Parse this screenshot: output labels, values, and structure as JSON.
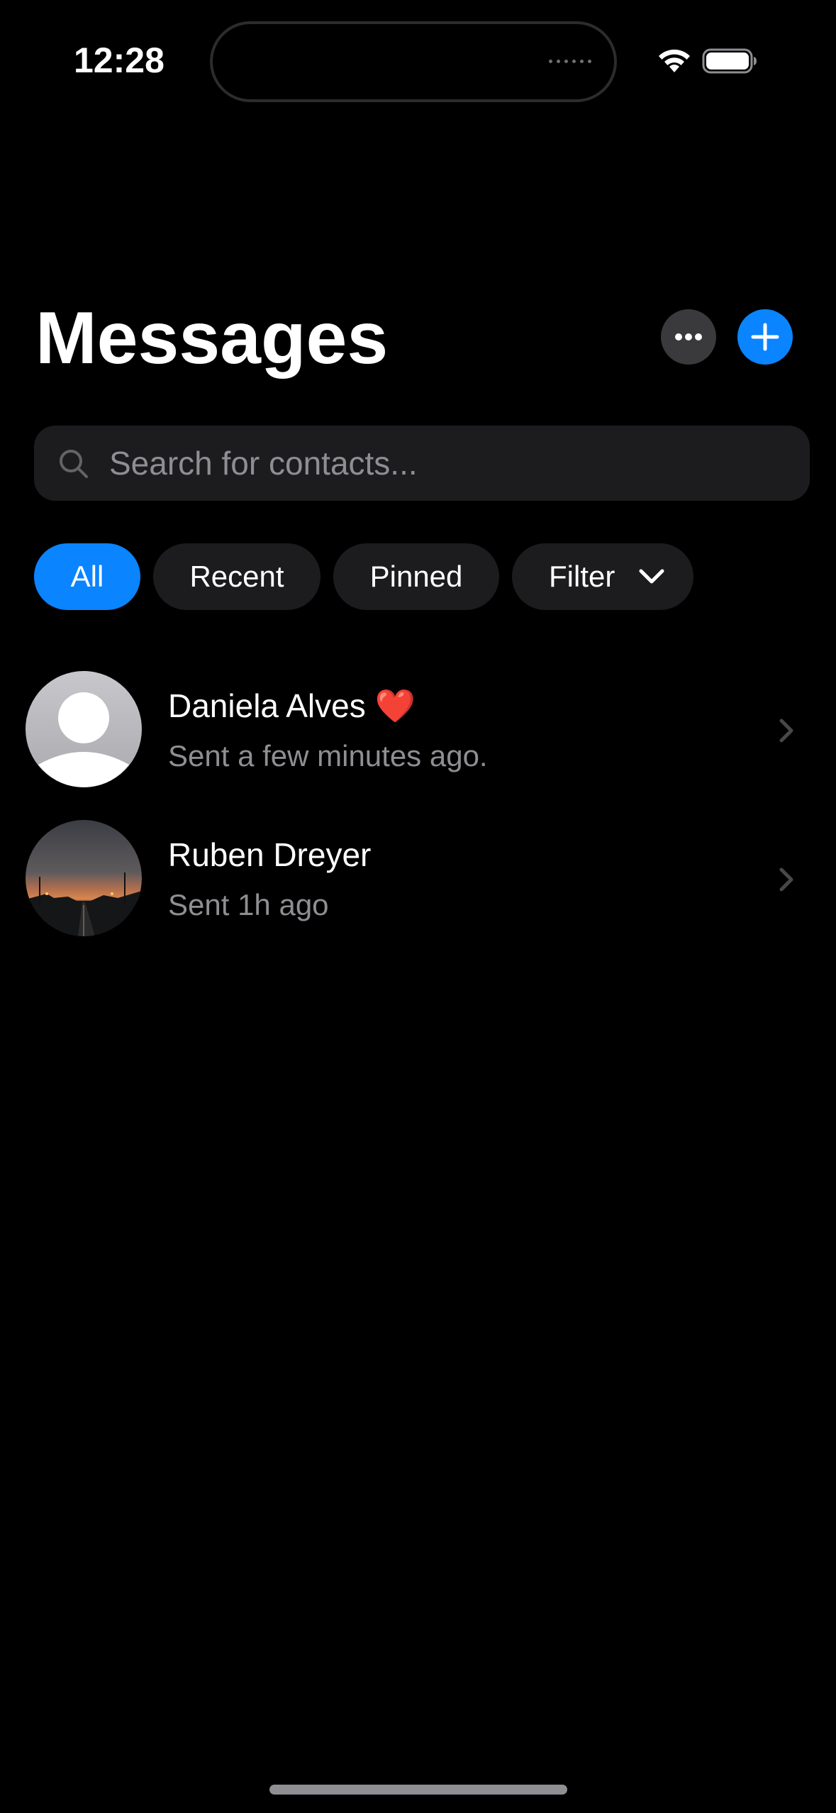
{
  "status_bar": {
    "time": "12:28"
  },
  "header": {
    "title": "Messages",
    "more_icon": "ellipsis-icon",
    "add_icon": "plus-icon"
  },
  "search": {
    "placeholder": "Search for contacts...",
    "value": ""
  },
  "filters": {
    "chips": [
      "All",
      "Recent",
      "Pinned",
      "Filter"
    ],
    "active": "All"
  },
  "conversations": [
    {
      "name": "Daniela Alves",
      "emoji": "❤️",
      "subtitle": "Sent a few minutes ago.",
      "avatar": "default-person-avatar"
    },
    {
      "name": "Ruben Dreyer",
      "subtitle": "Sent 1h ago",
      "avatar": "sunset-road-photo"
    }
  ],
  "colors": {
    "accent": "#0a84ff",
    "background": "#000000",
    "surface": "#1c1c1e",
    "secondary_text": "#8e8e93"
  }
}
